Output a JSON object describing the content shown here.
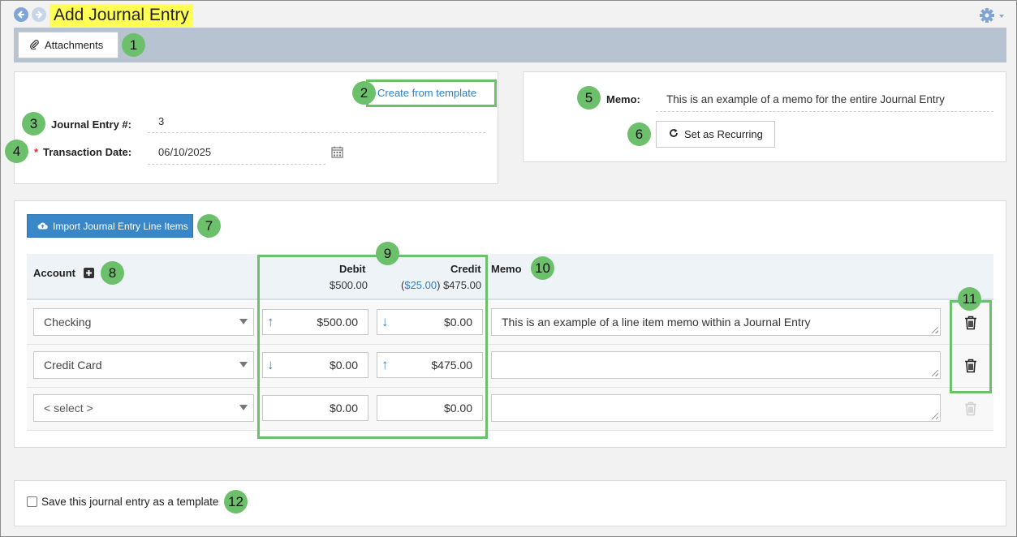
{
  "header": {
    "title": "Add Journal Entry"
  },
  "toolbar": {
    "attachments_label": "Attachments"
  },
  "entry": {
    "create_template_link": "Create from template",
    "journal_entry_label": "Journal Entry #:",
    "journal_entry_value": "3",
    "required_mark": "*",
    "transaction_date_label": "Transaction Date:",
    "transaction_date_value": "06/10/2025"
  },
  "memo_panel": {
    "memo_label": "Memo:",
    "memo_value": "This is an example of a memo for the entire Journal Entry",
    "recurring_label": "Set as Recurring"
  },
  "lines": {
    "import_label": "Import Journal Entry Line Items",
    "headers": {
      "account": "Account",
      "debit": "Debit",
      "credit": "Credit",
      "memo": "Memo"
    },
    "totals": {
      "debit": "$500.00",
      "credit_diff_open": "(",
      "credit_diff": "$25.00",
      "credit_diff_close": ")",
      "credit": "$475.00"
    },
    "rows": [
      {
        "account": "Checking",
        "debit": "$500.00",
        "credit": "$0.00",
        "memo": "This is an example of a line item memo within a Journal Entry"
      },
      {
        "account": "Credit Card",
        "debit": "$0.00",
        "credit": "$475.00",
        "memo": ""
      },
      {
        "account": "< select >",
        "debit": "$0.00",
        "credit": "$0.00",
        "memo": ""
      }
    ]
  },
  "footer": {
    "save_template_label": "Save this journal entry as a template"
  },
  "badges": [
    "1",
    "2",
    "3",
    "4",
    "5",
    "6",
    "7",
    "8",
    "9",
    "10",
    "11",
    "12"
  ],
  "colors": {
    "title_highlight": "#ffff55",
    "annotation_green": "#6cc06c",
    "primary_blue": "#3a87c8",
    "link_blue": "#2f7fc1",
    "toolbar_gray": "#b8c3d2"
  }
}
